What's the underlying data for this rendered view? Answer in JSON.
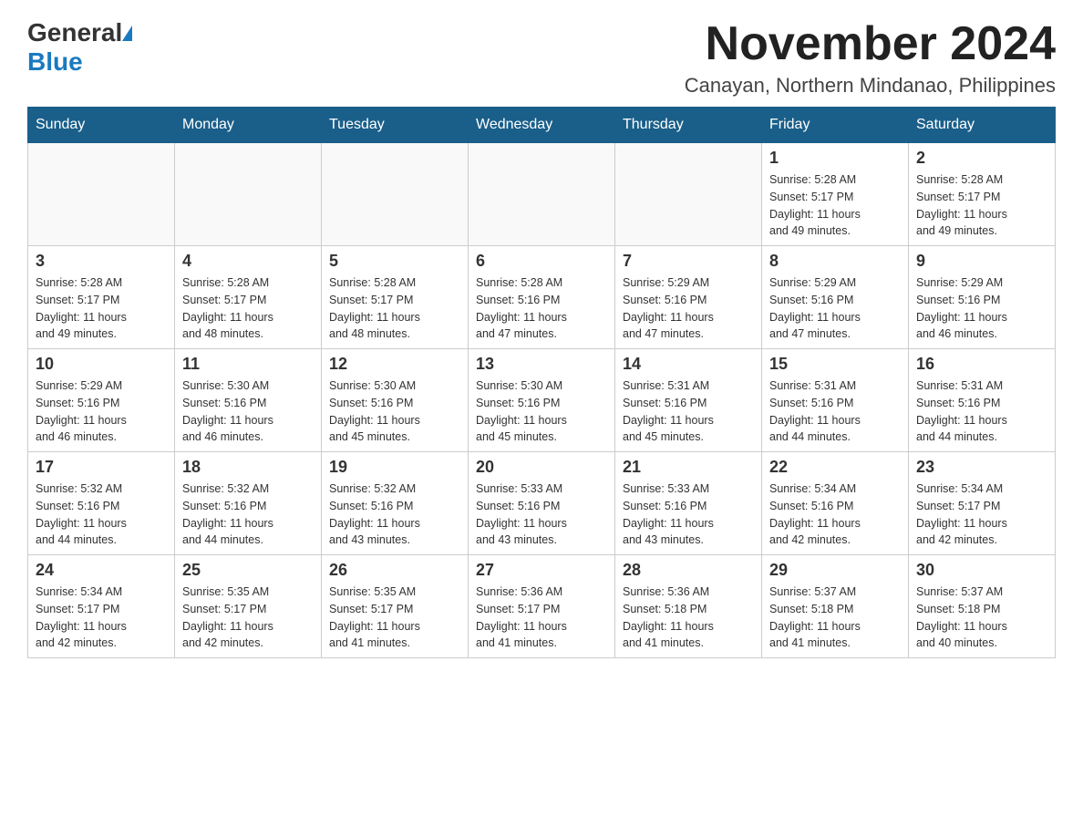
{
  "header": {
    "logo_general": "General",
    "logo_blue": "Blue",
    "month_title": "November 2024",
    "location": "Canayan, Northern Mindanao, Philippines"
  },
  "days_of_week": [
    "Sunday",
    "Monday",
    "Tuesday",
    "Wednesday",
    "Thursday",
    "Friday",
    "Saturday"
  ],
  "weeks": [
    [
      {
        "day": "",
        "info": ""
      },
      {
        "day": "",
        "info": ""
      },
      {
        "day": "",
        "info": ""
      },
      {
        "day": "",
        "info": ""
      },
      {
        "day": "",
        "info": ""
      },
      {
        "day": "1",
        "info": "Sunrise: 5:28 AM\nSunset: 5:17 PM\nDaylight: 11 hours\nand 49 minutes."
      },
      {
        "day": "2",
        "info": "Sunrise: 5:28 AM\nSunset: 5:17 PM\nDaylight: 11 hours\nand 49 minutes."
      }
    ],
    [
      {
        "day": "3",
        "info": "Sunrise: 5:28 AM\nSunset: 5:17 PM\nDaylight: 11 hours\nand 49 minutes."
      },
      {
        "day": "4",
        "info": "Sunrise: 5:28 AM\nSunset: 5:17 PM\nDaylight: 11 hours\nand 48 minutes."
      },
      {
        "day": "5",
        "info": "Sunrise: 5:28 AM\nSunset: 5:17 PM\nDaylight: 11 hours\nand 48 minutes."
      },
      {
        "day": "6",
        "info": "Sunrise: 5:28 AM\nSunset: 5:16 PM\nDaylight: 11 hours\nand 47 minutes."
      },
      {
        "day": "7",
        "info": "Sunrise: 5:29 AM\nSunset: 5:16 PM\nDaylight: 11 hours\nand 47 minutes."
      },
      {
        "day": "8",
        "info": "Sunrise: 5:29 AM\nSunset: 5:16 PM\nDaylight: 11 hours\nand 47 minutes."
      },
      {
        "day": "9",
        "info": "Sunrise: 5:29 AM\nSunset: 5:16 PM\nDaylight: 11 hours\nand 46 minutes."
      }
    ],
    [
      {
        "day": "10",
        "info": "Sunrise: 5:29 AM\nSunset: 5:16 PM\nDaylight: 11 hours\nand 46 minutes."
      },
      {
        "day": "11",
        "info": "Sunrise: 5:30 AM\nSunset: 5:16 PM\nDaylight: 11 hours\nand 46 minutes."
      },
      {
        "day": "12",
        "info": "Sunrise: 5:30 AM\nSunset: 5:16 PM\nDaylight: 11 hours\nand 45 minutes."
      },
      {
        "day": "13",
        "info": "Sunrise: 5:30 AM\nSunset: 5:16 PM\nDaylight: 11 hours\nand 45 minutes."
      },
      {
        "day": "14",
        "info": "Sunrise: 5:31 AM\nSunset: 5:16 PM\nDaylight: 11 hours\nand 45 minutes."
      },
      {
        "day": "15",
        "info": "Sunrise: 5:31 AM\nSunset: 5:16 PM\nDaylight: 11 hours\nand 44 minutes."
      },
      {
        "day": "16",
        "info": "Sunrise: 5:31 AM\nSunset: 5:16 PM\nDaylight: 11 hours\nand 44 minutes."
      }
    ],
    [
      {
        "day": "17",
        "info": "Sunrise: 5:32 AM\nSunset: 5:16 PM\nDaylight: 11 hours\nand 44 minutes."
      },
      {
        "day": "18",
        "info": "Sunrise: 5:32 AM\nSunset: 5:16 PM\nDaylight: 11 hours\nand 44 minutes."
      },
      {
        "day": "19",
        "info": "Sunrise: 5:32 AM\nSunset: 5:16 PM\nDaylight: 11 hours\nand 43 minutes."
      },
      {
        "day": "20",
        "info": "Sunrise: 5:33 AM\nSunset: 5:16 PM\nDaylight: 11 hours\nand 43 minutes."
      },
      {
        "day": "21",
        "info": "Sunrise: 5:33 AM\nSunset: 5:16 PM\nDaylight: 11 hours\nand 43 minutes."
      },
      {
        "day": "22",
        "info": "Sunrise: 5:34 AM\nSunset: 5:16 PM\nDaylight: 11 hours\nand 42 minutes."
      },
      {
        "day": "23",
        "info": "Sunrise: 5:34 AM\nSunset: 5:17 PM\nDaylight: 11 hours\nand 42 minutes."
      }
    ],
    [
      {
        "day": "24",
        "info": "Sunrise: 5:34 AM\nSunset: 5:17 PM\nDaylight: 11 hours\nand 42 minutes."
      },
      {
        "day": "25",
        "info": "Sunrise: 5:35 AM\nSunset: 5:17 PM\nDaylight: 11 hours\nand 42 minutes."
      },
      {
        "day": "26",
        "info": "Sunrise: 5:35 AM\nSunset: 5:17 PM\nDaylight: 11 hours\nand 41 minutes."
      },
      {
        "day": "27",
        "info": "Sunrise: 5:36 AM\nSunset: 5:17 PM\nDaylight: 11 hours\nand 41 minutes."
      },
      {
        "day": "28",
        "info": "Sunrise: 5:36 AM\nSunset: 5:18 PM\nDaylight: 11 hours\nand 41 minutes."
      },
      {
        "day": "29",
        "info": "Sunrise: 5:37 AM\nSunset: 5:18 PM\nDaylight: 11 hours\nand 41 minutes."
      },
      {
        "day": "30",
        "info": "Sunrise: 5:37 AM\nSunset: 5:18 PM\nDaylight: 11 hours\nand 40 minutes."
      }
    ]
  ]
}
